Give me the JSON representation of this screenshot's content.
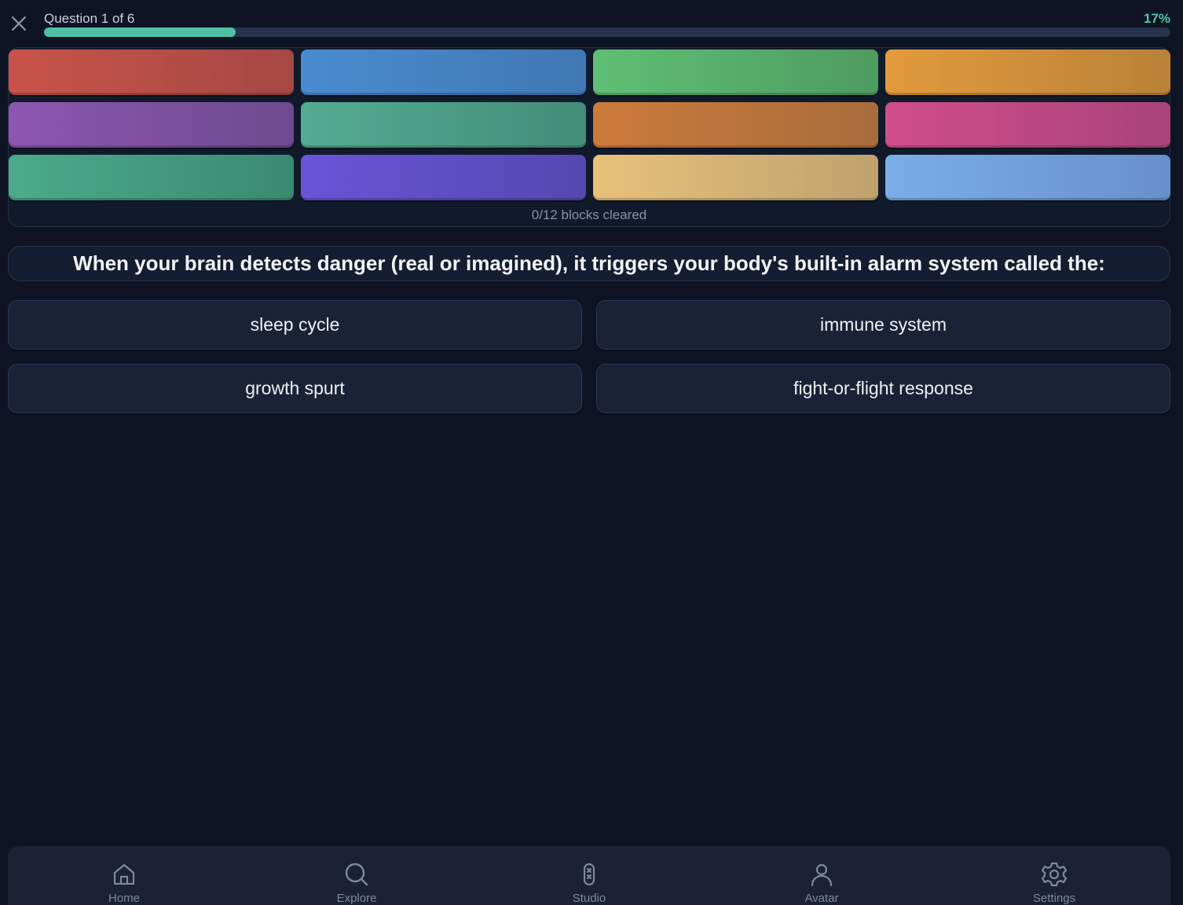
{
  "header": {
    "progress_label": "Question 1 of 6",
    "progress_percent_text": "17%",
    "progress_value": 0.17
  },
  "board": {
    "blocks": [
      {
        "color_start": "#c9534a",
        "color_end": "#a54844"
      },
      {
        "color_start": "#4a8bd0",
        "color_end": "#3f78b3"
      },
      {
        "color_start": "#5fbf74",
        "color_end": "#4e9b62"
      },
      {
        "color_start": "#e39a3c",
        "color_end": "#b98238"
      },
      {
        "color_start": "#8c57b0",
        "color_end": "#6e4a8f"
      },
      {
        "color_start": "#52ac92",
        "color_end": "#438d79"
      },
      {
        "color_start": "#cc7a3a",
        "color_end": "#a86d3c"
      },
      {
        "color_start": "#d14d8c",
        "color_end": "#a8447a"
      },
      {
        "color_start": "#4aab8b",
        "color_end": "#3b8a72"
      },
      {
        "color_start": "#6a54d8",
        "color_end": "#5548b0"
      },
      {
        "color_start": "#e8c27a",
        "color_end": "#bea26e"
      },
      {
        "color_start": "#7aaee8",
        "color_end": "#6690cc"
      }
    ],
    "status": "0/12 blocks cleared"
  },
  "question": {
    "text": "When your brain detects danger (real or imagined), it triggers your body's built-in alarm system called the:"
  },
  "answers": [
    {
      "label": "sleep cycle"
    },
    {
      "label": "immune system"
    },
    {
      "label": "growth spurt"
    },
    {
      "label": "fight-or-flight response"
    }
  ],
  "nav": [
    {
      "label": "Home",
      "icon": "home-icon"
    },
    {
      "label": "Explore",
      "icon": "search-icon"
    },
    {
      "label": "Studio",
      "icon": "studio-icon"
    },
    {
      "label": "Avatar",
      "icon": "person-icon"
    },
    {
      "label": "Settings",
      "icon": "gear-icon"
    }
  ],
  "colors": {
    "background": "#0e1424",
    "accent": "#4fc1a2",
    "card": "#1a2235"
  }
}
